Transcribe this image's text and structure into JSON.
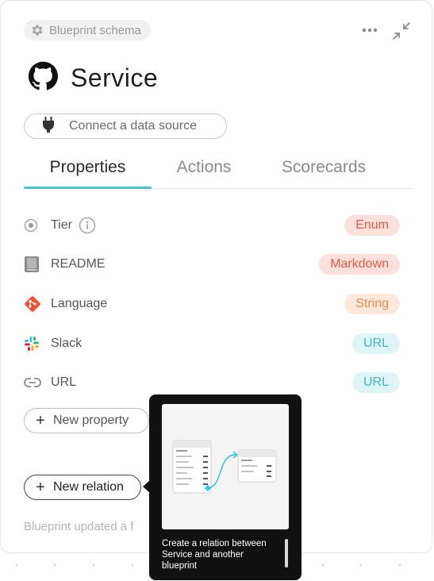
{
  "header": {
    "schema_chip": "Blueprint schema",
    "title": "Service",
    "connect_label": "Connect a data source"
  },
  "tabs": [
    {
      "label": "Properties",
      "active": true
    },
    {
      "label": "Actions",
      "active": false
    },
    {
      "label": "Scorecards",
      "active": false
    }
  ],
  "properties": [
    {
      "label": "Tier",
      "icon": "enum-radio-icon",
      "type": "Enum",
      "has_info": true
    },
    {
      "label": "README",
      "icon": "book-icon",
      "type": "Markdown"
    },
    {
      "label": "Language",
      "icon": "git-icon",
      "type": "String"
    },
    {
      "label": "Slack",
      "icon": "slack-icon",
      "type": "URL"
    },
    {
      "label": "URL",
      "icon": "link-icon",
      "type": "URL"
    }
  ],
  "buttons": {
    "new_property": "New property",
    "new_relation": "New relation"
  },
  "footer": {
    "updated_text": "Blueprint updated a f"
  },
  "tooltip": {
    "text": "Create a relation between Service and another blueprint"
  },
  "colors": {
    "accent": "#3fc8d8",
    "enum_bg": "#fde0dc",
    "enum_fg": "#e35d4b",
    "markdown_bg": "#fde0dc",
    "markdown_fg": "#e35d4b",
    "string_bg": "#fde9dc",
    "string_fg": "#f08a4b",
    "url_bg": "#dff4f6",
    "url_fg": "#3fb8c8"
  }
}
